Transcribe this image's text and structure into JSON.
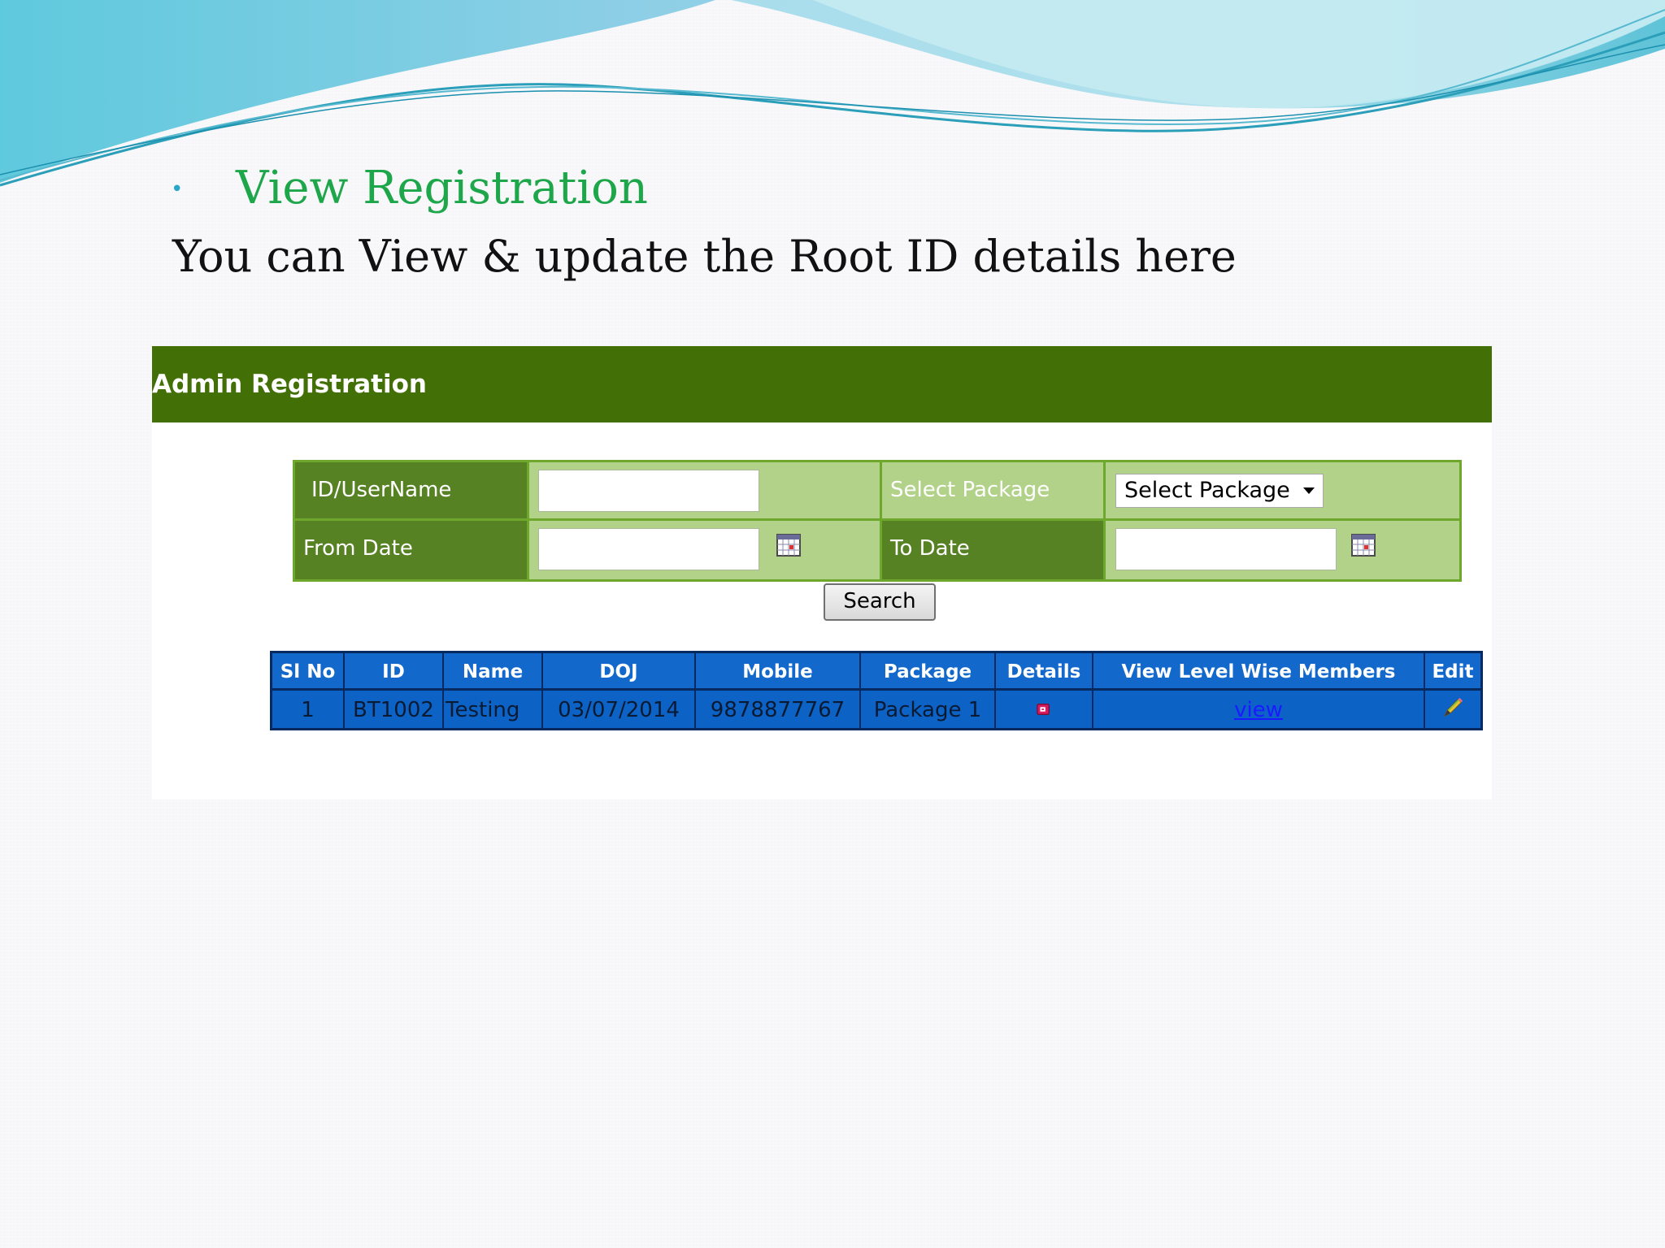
{
  "slide": {
    "bullet": "•",
    "title": "View Registration",
    "subtitle": "You can View & update the Root ID details here"
  },
  "panel": {
    "header_title": "Admin Registration",
    "form": {
      "id_label": "ID/UserName",
      "id_value": "",
      "package_label": "Select Package",
      "package_selected": "Select Package",
      "from_label": "From Date",
      "from_value": "",
      "to_label": "To Date",
      "to_value": "",
      "search_label": "Search"
    },
    "table": {
      "headers": [
        "Sl No",
        "ID",
        "Name",
        "DOJ",
        "Mobile",
        "Package",
        "Details",
        "View Level Wise Members",
        "Edit"
      ],
      "rows": [
        [
          "1",
          "BT1002",
          "Testing",
          "03/07/2014",
          "9878877767",
          "Package 1",
          "",
          "view",
          ""
        ]
      ]
    }
  },
  "icons": {
    "calendar": "calendar-icon",
    "details": "details-icon",
    "edit": "pencil-icon"
  },
  "colors": {
    "header_green": "#436f07",
    "label_green": "#578224",
    "field_green": "#b1d288",
    "table_blue": "#0c63c5",
    "title_green": "#1ea64a"
  }
}
